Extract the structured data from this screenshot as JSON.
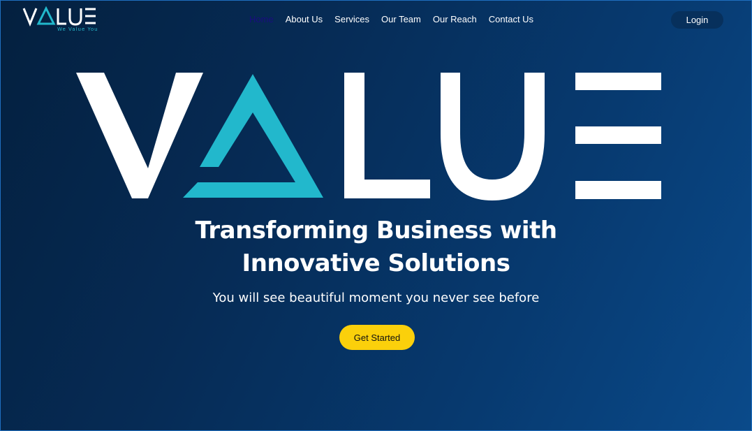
{
  "brand": {
    "logo_alt": "VALUE",
    "tagline": "We Value You",
    "colors": {
      "accent": "#22b8cc",
      "button": "#fbd00b",
      "bg_dark": "#04203f",
      "bg_light": "#0a4a8a"
    }
  },
  "nav": {
    "items": [
      {
        "label": "Home",
        "active": true
      },
      {
        "label": "About Us"
      },
      {
        "label": "Services"
      },
      {
        "label": "Our Team"
      },
      {
        "label": "Our Reach"
      },
      {
        "label": "Contact Us"
      }
    ],
    "login_label": "Login"
  },
  "hero": {
    "headline_line1": "Transforming Business with",
    "headline_line2": "Innovative Solutions",
    "subtext": "You will see beautiful moment you never see before",
    "cta_label": "Get Started"
  }
}
